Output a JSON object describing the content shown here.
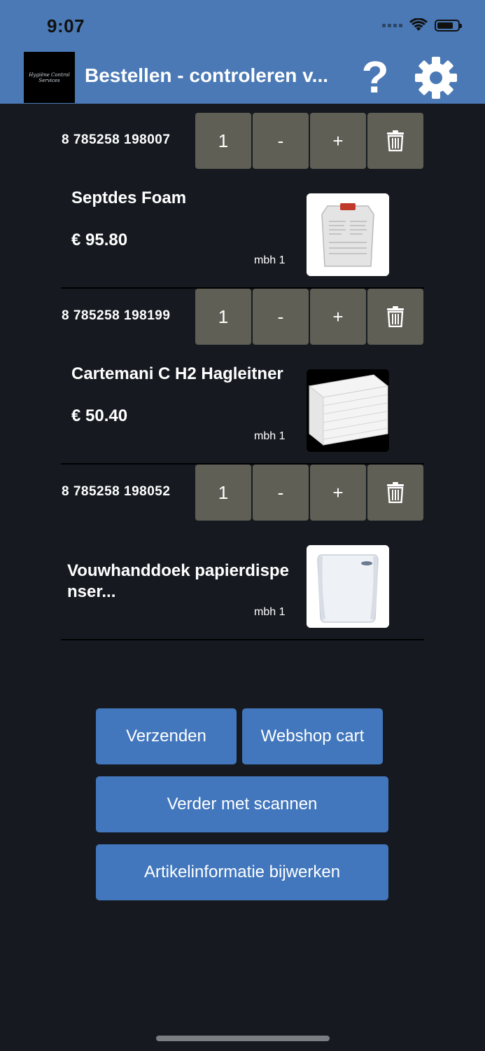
{
  "status_bar": {
    "time": "9:07"
  },
  "header": {
    "logo_text": "Hygiëne Control",
    "logo_sub": "Services",
    "title": "Bestellen - controleren v...",
    "help_glyph": "?",
    "help_icon": "help-icon",
    "settings_icon": "gear-icon"
  },
  "items": [
    {
      "code": "8 785258 198007",
      "qty": "1",
      "minus": "-",
      "plus": "+",
      "name": "Septdes Foam",
      "price": "€ 95.80",
      "mbh": "mbh  1"
    },
    {
      "code": "8 785258 198199",
      "qty": "1",
      "minus": "-",
      "plus": "+",
      "name": "Cartemani C H2 Hagleitner",
      "price": "€ 50.40",
      "mbh": "mbh  1"
    },
    {
      "code": "8 785258 198052",
      "qty": "1",
      "minus": "-",
      "plus": "+",
      "name": "Vouwhanddoek papierdispe nser...",
      "price": "",
      "mbh": "mbh  1"
    }
  ],
  "actions": {
    "send": "Verzenden",
    "webshop": "Webshop cart",
    "continue_scan": "Verder met scannen",
    "update_info": "Artikelinformatie bijwerken"
  },
  "colors": {
    "header_bg": "#4a79b5",
    "page_bg": "#161a20",
    "control_bg": "#5f5f55",
    "button_bg": "#4277bd"
  }
}
